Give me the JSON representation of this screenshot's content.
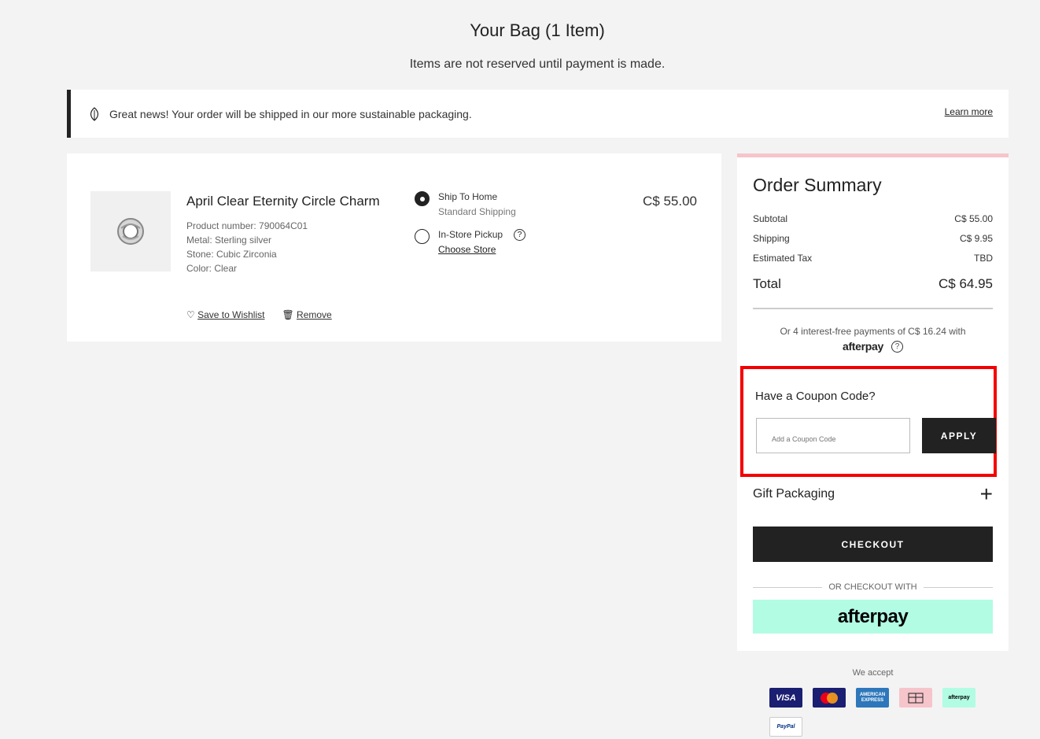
{
  "page": {
    "title": "Your Bag (1 Item)",
    "subtitle": "Items are not reserved until payment is made."
  },
  "banner": {
    "message": "Great news! Your order will be shipped in our more sustainable packaging.",
    "link": "Learn more"
  },
  "item": {
    "name": "April Clear Eternity Circle Charm",
    "details": [
      "Product number: 790064C01",
      "Metal: Sterling silver",
      "Stone: Cubic Zirconia",
      "Color: Clear"
    ],
    "price": "C$ 55.00",
    "wishlist_label": "Save to Wishlist",
    "remove_label": "Remove",
    "shipping_options": [
      {
        "label": "Ship To Home",
        "sub": "Standard Shipping",
        "selected": true
      },
      {
        "label": "In-Store Pickup",
        "sub": "Choose Store",
        "selected": false
      }
    ]
  },
  "summary": {
    "title": "Order Summary",
    "rows": [
      {
        "label": "Subtotal",
        "value": "C$ 55.00"
      },
      {
        "label": "Shipping",
        "value": "C$ 9.95"
      },
      {
        "label": "Estimated Tax",
        "value": "TBD"
      }
    ],
    "total_label": "Total",
    "total_value": "C$ 64.95",
    "afterpay_text": "Or 4 interest-free payments of C$ 16.24 with",
    "afterpay_logo": "afterpay",
    "coupon_title": "Have a Coupon Code?",
    "coupon_placeholder": "Add a Coupon Code",
    "apply_label": "APPLY",
    "gift_label": "Gift Packaging",
    "checkout_label": "CHECKOUT",
    "or_checkout_label": "OR CHECKOUT WITH",
    "afterpay_button": "afterpay"
  },
  "payments": {
    "label": "We accept",
    "cards": [
      {
        "name": "VISA",
        "bg": "#1a1f71",
        "fg": "#ffffff"
      },
      {
        "name": "MasterCard",
        "bg": "#1a1f71",
        "fg": "#ffffff"
      },
      {
        "name": "AMERICAN EXPRESS",
        "bg": "#2e77bb",
        "fg": "#ffffff"
      },
      {
        "name": "gift-card",
        "bg": "#f6c4cb",
        "fg": "#222222"
      },
      {
        "name": "afterpay",
        "bg": "#b2fce4",
        "fg": "#000000"
      },
      {
        "name": "PayPal",
        "bg": "#ffffff",
        "fg": "#003087"
      }
    ]
  },
  "colors": {
    "accent_dark": "#222222",
    "summary_top_border": "#f6c4cb",
    "highlight_red": "#f40000",
    "afterpay_mint": "#b2fce4"
  }
}
